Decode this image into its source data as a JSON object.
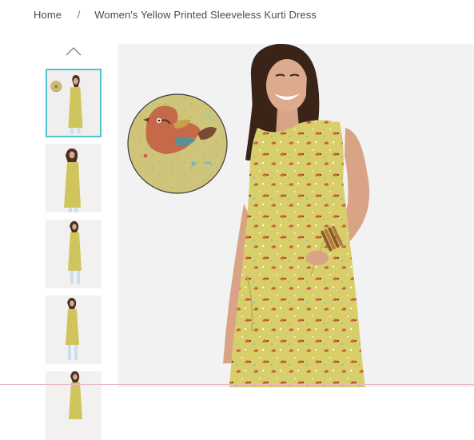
{
  "breadcrumb": {
    "home": "Home",
    "separator": "/",
    "current": "Women's Yellow Printed Sleeveless Kurti Dress"
  },
  "gallery": {
    "thumbnails": [
      {
        "label": "",
        "active": true
      },
      {
        "label": "",
        "active": false
      },
      {
        "label": "",
        "active": false
      },
      {
        "label": "",
        "active": false
      },
      {
        "label": "",
        "active": false
      }
    ]
  },
  "colors": {
    "accent": "#4fc3d2",
    "dress": "#d9cf6a",
    "background": "#f3f2f2"
  },
  "icons": {
    "prev": "chevron-up-icon"
  }
}
